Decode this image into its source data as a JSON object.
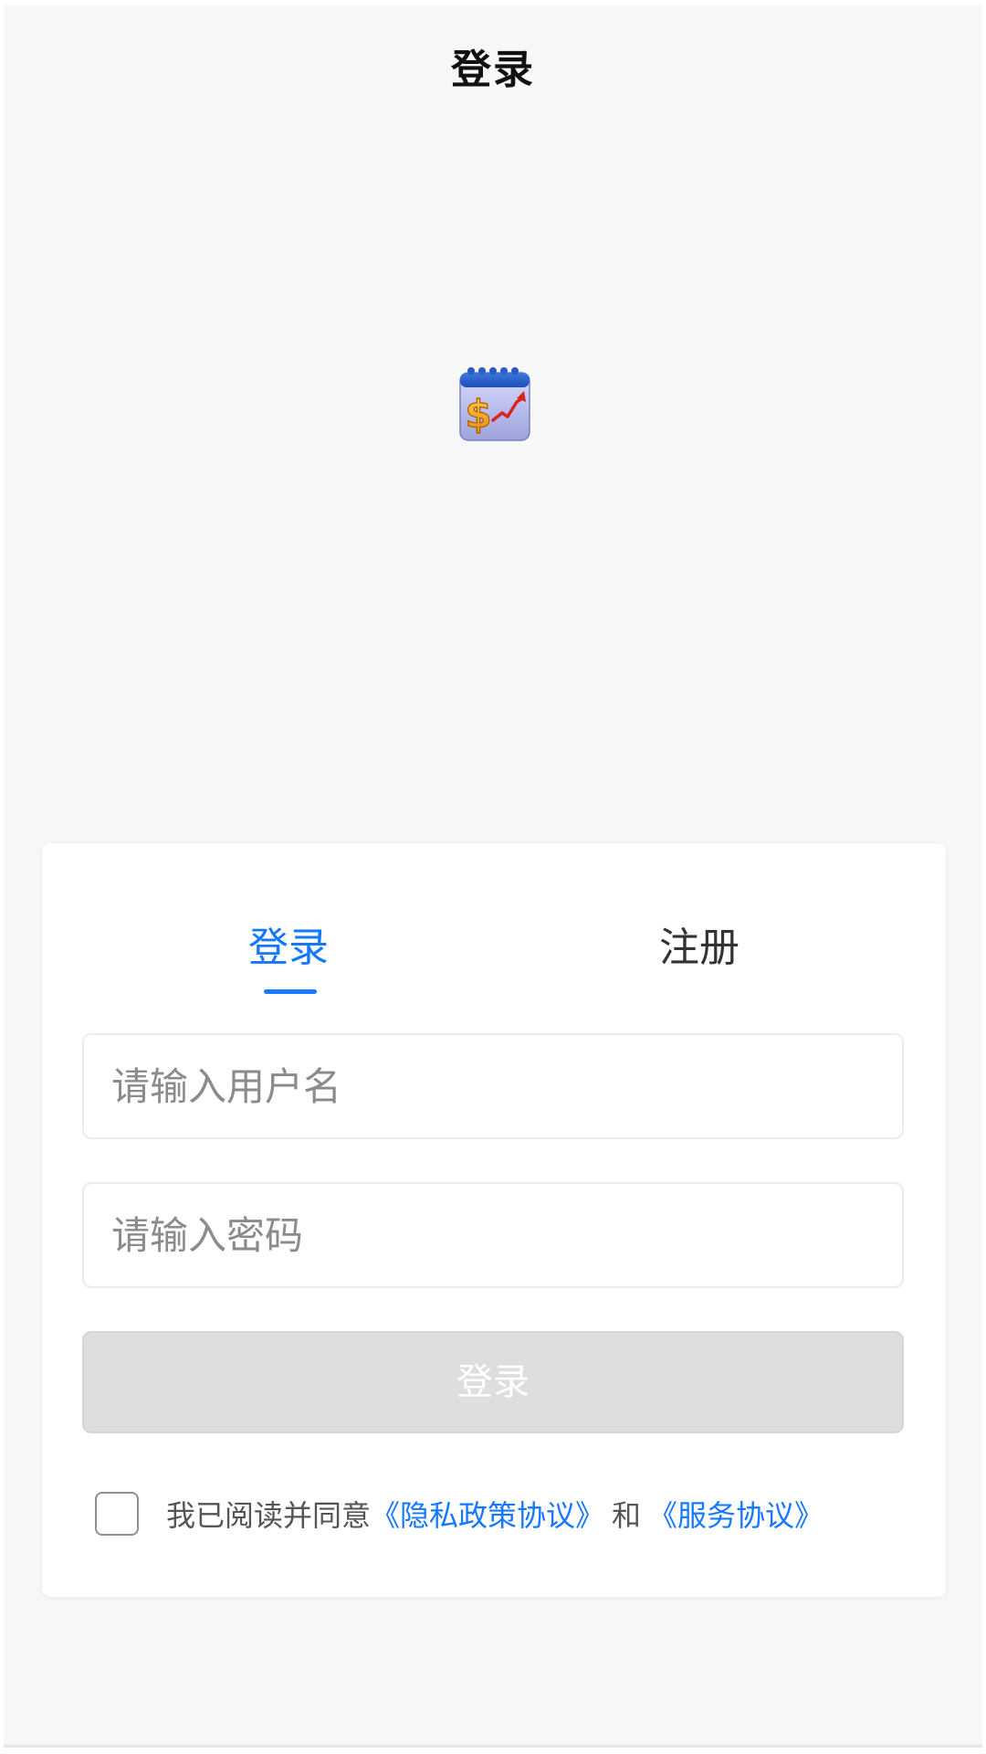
{
  "header": {
    "title": "登录"
  },
  "app_icon": {
    "name": "calendar-dollar-chart-icon"
  },
  "tabs": [
    {
      "label": "登录",
      "active": true
    },
    {
      "label": "注册",
      "active": false
    }
  ],
  "form": {
    "username_placeholder": "请输入用户名",
    "password_placeholder": "请输入密码",
    "submit_label": "登录"
  },
  "agreement": {
    "prefix": "我已阅读并同意",
    "privacy_link": "《隐私政策协议》",
    "and_text": "和",
    "service_link": "《服务协议》"
  },
  "colors": {
    "accent": "#1677ff",
    "background": "#f7f7f8",
    "disabled_button": "#dedede"
  }
}
